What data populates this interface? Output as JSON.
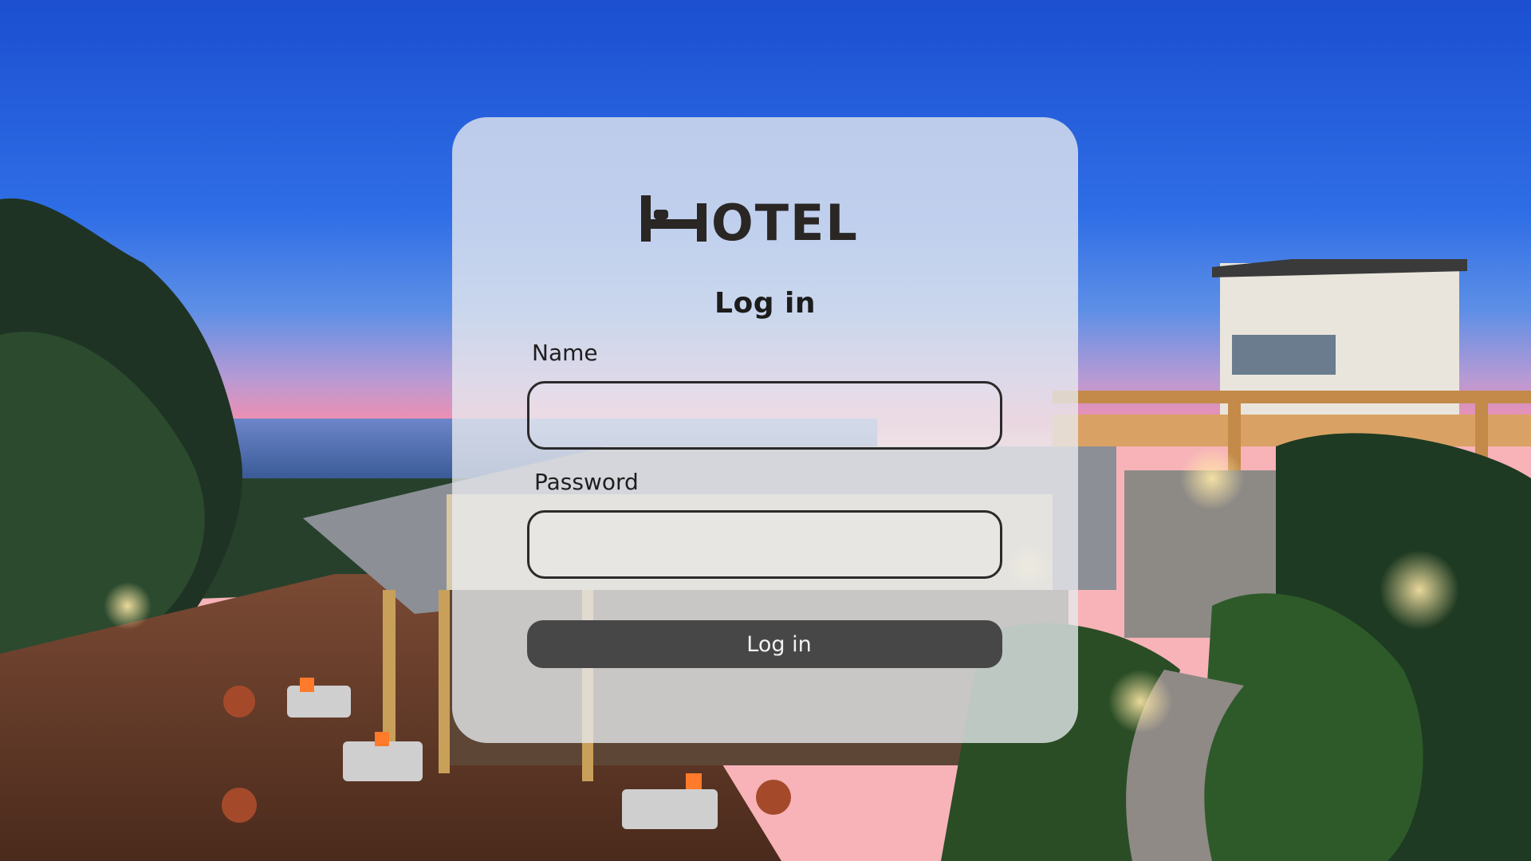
{
  "brand": {
    "logo_text": "HOTEL",
    "logo_color": "#2a2624"
  },
  "login": {
    "heading": "Log in",
    "name_label": "Name",
    "name_value": "",
    "password_label": "Password",
    "password_value": "",
    "submit_label": "Log in"
  },
  "colors": {
    "card_background": "#e8eaee",
    "button_background": "#474747",
    "button_text": "#f2f2f2",
    "field_border": "#2a2a2a"
  }
}
